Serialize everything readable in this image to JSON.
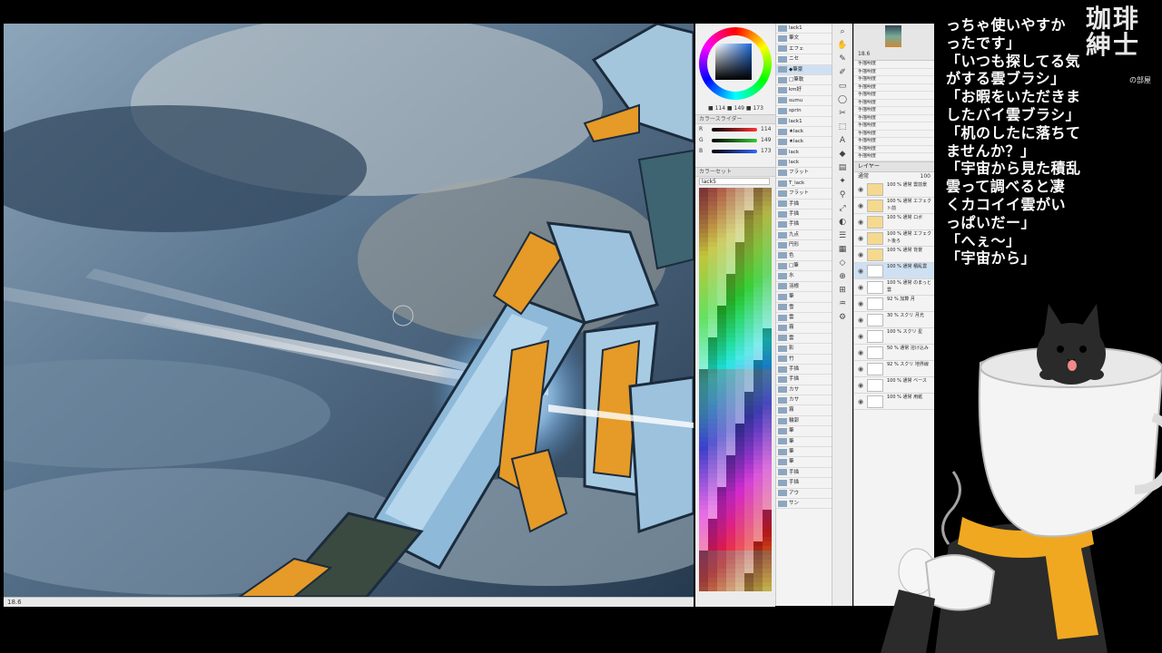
{
  "logo": {
    "line1": "珈琲",
    "line2": "紳士",
    "sub": "の部屋"
  },
  "chat": {
    "lines": [
      "っちゃ使いやすか",
      "ったです」",
      "「いつも探してる気",
      "がする雲ブラシ」",
      "「お暇をいただきま",
      "したバイ雲ブラシ」",
      "「机のしたに落ちて",
      "ませんか？」",
      "「宇宙から見た積乱",
      "雲って調べると凄",
      "くカコイイ雲がい",
      "っぱいだー」",
      "「へぇ〜」",
      "「宇宙から」"
    ]
  },
  "color_panel": {
    "readout": "■ 114 ■ 149 ■ 173",
    "slider_title": "カラースライダー",
    "sliders": [
      {
        "label": "R",
        "value": "114",
        "color": "#7295ad"
      },
      {
        "label": "G",
        "value": "149",
        "color": "#5aa35a"
      },
      {
        "label": "B",
        "value": "173",
        "color": "#4a6ad0"
      }
    ],
    "current_color": "#7295ad"
  },
  "colorset": {
    "title": "カラーセット",
    "selected": "lack5"
  },
  "brushes": {
    "items": [
      "lack1",
      "筆文",
      "エフェ",
      "ニセ",
      "◆筆豪",
      "□筆軟",
      "km好",
      "sumu",
      "sprin",
      "lack1",
      "★lack",
      "★lack",
      "lack",
      "lack",
      "フラット",
      "T_lack",
      "フラット",
      "手描",
      "手描",
      "手描",
      "九点",
      "円形",
      "色",
      "□筆",
      "水",
      "羽根",
      "筆",
      "雪",
      "雲",
      "霧",
      "雲",
      "影",
      "竹",
      "手描",
      "手描",
      "カサ",
      "カサ",
      "霧",
      "輪郭",
      "筆",
      "筆",
      "筆",
      "筆",
      "手描",
      "手描",
      "アウ",
      "サン"
    ],
    "selected_index": 4
  },
  "tools": [
    "⌕",
    "✋",
    "✎",
    "✐",
    "▭",
    "◯",
    "✂",
    "⬚",
    "A",
    "◆",
    "▤",
    "✦",
    "⚲",
    "⤢",
    "◐",
    "☰",
    "▦",
    "◇",
    "⊕",
    "⊞",
    "♒",
    "⚙"
  ],
  "navigator": {
    "zoom": "18.6"
  },
  "sub_items": [
    "手描明度",
    "手描明度",
    "手描明度",
    "手描明度",
    "手描明度",
    "手描明度",
    "手描明度",
    "手描明度",
    "手描明度",
    "手描明度",
    "手描明度",
    "手描明度",
    "手描明度"
  ],
  "layers": {
    "header": "レイヤー",
    "blend": "通常",
    "opacity": "100",
    "items": [
      {
        "name": "100 % 通常 雲前景",
        "folder": true
      },
      {
        "name": "100 % 通常 エフェクト前",
        "folder": true
      },
      {
        "name": "100 % 通常 ロボ",
        "folder": true
      },
      {
        "name": "100 % 通常 エフェクト後ろ",
        "folder": true
      },
      {
        "name": "100 % 通常 背景",
        "folder": true
      },
      {
        "name": "100 % 通常 積乱雲",
        "folder": false,
        "selected": true
      },
      {
        "name": "100 % 通常 のまっと雲",
        "folder": false
      },
      {
        "name": "92 % 加算 月",
        "folder": false
      },
      {
        "name": "30 % スクリ 月光",
        "folder": false
      },
      {
        "name": "100 % スクリ 星",
        "folder": false
      },
      {
        "name": "50 % 通常 溶け込み",
        "folder": false
      },
      {
        "name": "92 % スクリ 地界線",
        "folder": false
      },
      {
        "name": "100 % 通常 ベース",
        "folder": false
      },
      {
        "name": "100 % 通常 用紙",
        "folder": false
      }
    ]
  },
  "canvas_status": "18.6"
}
